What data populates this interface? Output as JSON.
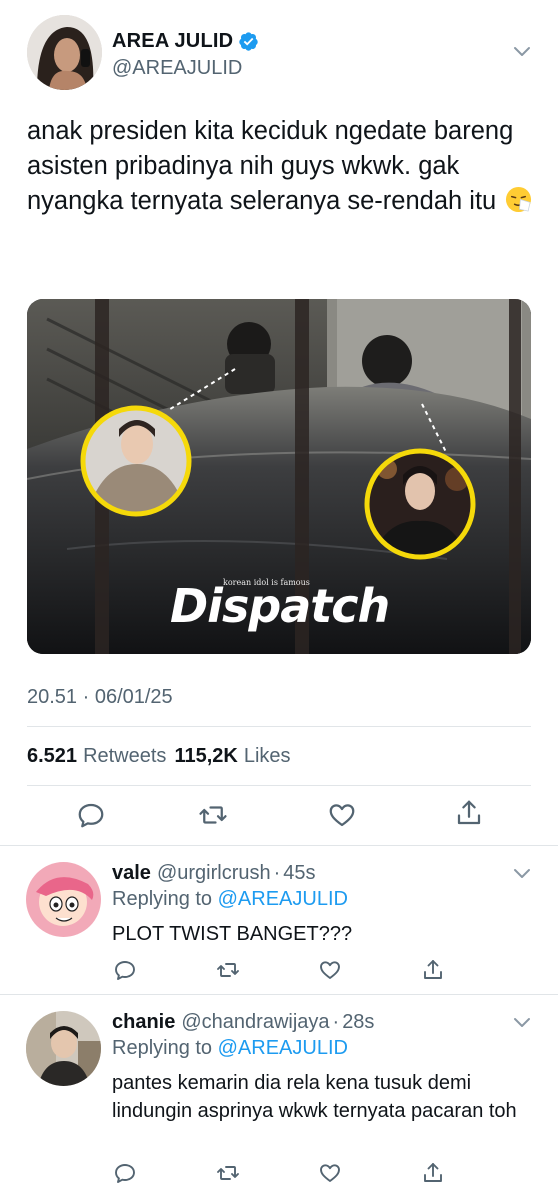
{
  "tweet": {
    "author_name": "AREA JULID",
    "author_handle": "@AREAJULID",
    "text": "anak presiden kita keciduk ngedate bareng asisten pribadinya nih guys wkwk. gak nyangka ternyata seleranya se-rendah itu",
    "emoji": "sneezing-face-emoji",
    "media": {
      "watermark": "Dispatch",
      "watermark_tagline": "korean idol is famous"
    },
    "timestamp": "20.51 · 06/01/25",
    "retweets_count": "6.521",
    "retweets_label": "Retweets",
    "likes_count": "115,2K",
    "likes_label": "Likes",
    "actions": [
      "reply-icon",
      "retweet-icon",
      "like-icon",
      "share-icon"
    ]
  },
  "replies": [
    {
      "name": "vale",
      "handle": "@urgirlcrush",
      "dot": "·",
      "time": "45s",
      "replying_prefix": "Replying to",
      "replying_to": "@AREAJULID",
      "text": "PLOT TWIST BANGET???"
    },
    {
      "name": "chanie",
      "handle": "@chandrawijaya",
      "dot": "·",
      "time": "28s",
      "replying_prefix": "Replying to",
      "replying_to": "@AREAJULID",
      "text": "pantes kemarin dia rela kena tusuk demi lindungin asprinya wkwk ternyata pacaran toh"
    }
  ],
  "colors": {
    "text": "#0f1419",
    "secondary": "#536471",
    "accent": "#1d9bf0",
    "divider": "#e1e5e8",
    "highlight_ring": "#f5d90a"
  }
}
